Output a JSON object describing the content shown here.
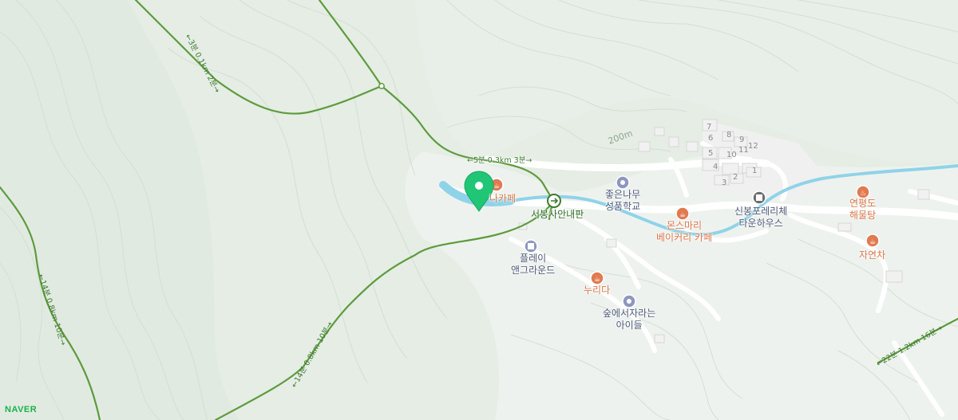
{
  "map": {
    "provider": "NAVER",
    "colors": {
      "terrain": "#e6eee6",
      "trail": "#5d9b3c",
      "water": "#8fd3e8",
      "cafe_poi": "#e07a4f",
      "edu_poi": "#8e96c0",
      "marker": "#20c676"
    },
    "contour_label": "200m",
    "places": [
      {
        "id": "cafe1",
        "label": "나카페",
        "icon": "cafe-icon"
      },
      {
        "id": "school",
        "label": "좋은나무\n성품학교",
        "icon": "school-icon"
      },
      {
        "id": "bakery",
        "label": "몬스마리\n베이커리 카페",
        "icon": "cafe-icon"
      },
      {
        "id": "town",
        "label": "신봉포레리체\n타운하우스",
        "icon": "apartment-icon"
      },
      {
        "id": "restaurant",
        "label": "연평도\n해물탕",
        "icon": "restaurant-icon"
      },
      {
        "id": "cafe2",
        "label": "자연차",
        "icon": "cafe-icon"
      },
      {
        "id": "play",
        "label": "플레이\n앤그라운드",
        "icon": "building-icon"
      },
      {
        "id": "nurida",
        "label": "누리다",
        "icon": "cafe-icon"
      },
      {
        "id": "forest",
        "label": "숲에서자라는\n아이들",
        "icon": "school-icon"
      },
      {
        "id": "guide",
        "label": "서봉사안내판",
        "icon": "trailhead-icon"
      }
    ],
    "building_numbers": [
      "7",
      "6",
      "8",
      "9",
      "5",
      "10",
      "11",
      "12",
      "4",
      "2",
      "3",
      "1"
    ],
    "trail_labels": [
      "←5분 0.3km 3분→",
      "←14분 0.8km 10분→",
      "←14분 0.8km 10분→",
      "←22분 1.2km 16분→",
      "←3분 0.1km 2분→"
    ]
  }
}
